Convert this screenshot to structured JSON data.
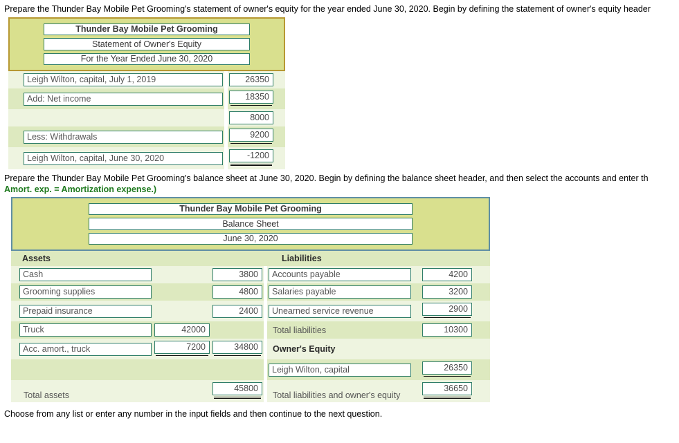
{
  "prompts": {
    "equity_prompt": "Prepare the Thunder Bay Mobile Pet Grooming's statement of owner's equity for the year ended June 30, 2020. Begin by defining the statement of owner's equity header",
    "balance_prompt_line1": "Prepare the Thunder Bay Mobile Pet Grooming's balance sheet at June 30, 2020. Begin by defining the balance sheet header, and then select the accounts and enter th",
    "balance_prompt_hint": "Amort. exp. = Amortization expense.)",
    "footer": "Choose from any list or enter any number in the input fields and then continue to the next question."
  },
  "equity_statement": {
    "header": {
      "company": "Thunder Bay Mobile Pet Grooming",
      "title": "Statement of Owner's Equity",
      "period": "For the Year Ended June 30, 2020"
    },
    "rows": [
      {
        "label": "Leigh Wilton, capital, July 1, 2019",
        "amount": "26350",
        "underline": "none"
      },
      {
        "label": "Add: Net income",
        "amount": "18350",
        "underline": "single"
      },
      {
        "label": "",
        "amount": "8000",
        "underline": "none"
      },
      {
        "label": "Less: Withdrawals",
        "amount": "9200",
        "underline": "single"
      },
      {
        "label": "Leigh Wilton, capital, June 30, 2020",
        "amount": "-1200",
        "underline": "double"
      }
    ]
  },
  "balance_sheet": {
    "header": {
      "company": "Thunder Bay Mobile Pet Grooming",
      "title": "Balance Sheet",
      "period": "June 30, 2020"
    },
    "section_headings": {
      "assets": "Assets",
      "liabilities": "Liabilities",
      "owners_equity": "Owner's Equity"
    },
    "asset_rows": [
      {
        "label": "Cash",
        "col1": "",
        "col2": "3800",
        "label_kind": "field",
        "col1_kind": "blank",
        "col2_kind": "field",
        "underline": "none"
      },
      {
        "label": "Grooming supplies",
        "col1": "",
        "col2": "4800",
        "label_kind": "field",
        "col1_kind": "blank",
        "col2_kind": "field",
        "underline": "none"
      },
      {
        "label": "Prepaid insurance",
        "col1": "",
        "col2": "2400",
        "label_kind": "field",
        "col1_kind": "blank",
        "col2_kind": "field",
        "underline": "none"
      },
      {
        "label": "Truck",
        "col1": "42000",
        "col2": "",
        "label_kind": "field",
        "col1_kind": "field",
        "col2_kind": "blank",
        "underline": "none"
      },
      {
        "label": "Acc. amort., truck",
        "col1": "7200",
        "col2": "34800",
        "label_kind": "field",
        "col1_kind": "field",
        "col2_kind": "field",
        "underline": "single"
      },
      {
        "label": "",
        "col1": "",
        "col2": "",
        "label_kind": "blank",
        "col1_kind": "blank",
        "col2_kind": "blank",
        "underline": "none"
      },
      {
        "label": "Total assets",
        "col1": "",
        "col2": "45800",
        "label_kind": "plain",
        "col1_kind": "blank",
        "col2_kind": "field",
        "underline": "double"
      }
    ],
    "liability_rows": [
      {
        "label": "Accounts payable",
        "amount": "4200",
        "label_kind": "field",
        "amount_kind": "field",
        "underline": "none",
        "bold": false
      },
      {
        "label": "Salaries payable",
        "amount": "3200",
        "label_kind": "field",
        "amount_kind": "field",
        "underline": "none",
        "bold": false
      },
      {
        "label": "Unearned service revenue",
        "amount": "2900",
        "label_kind": "field",
        "amount_kind": "field",
        "underline": "single",
        "bold": false
      },
      {
        "label": "Total liabilities",
        "amount": "10300",
        "label_kind": "plain",
        "amount_kind": "field",
        "underline": "none",
        "bold": false
      },
      {
        "label": "Owner's Equity",
        "amount": "",
        "label_kind": "bold",
        "amount_kind": "blank",
        "underline": "none",
        "bold": true
      },
      {
        "label": "Leigh Wilton, capital",
        "amount": "26350",
        "label_kind": "field",
        "amount_kind": "field",
        "underline": "single",
        "bold": false
      },
      {
        "label": "Total liabilities and owner's equity",
        "amount": "36650",
        "label_kind": "plain",
        "amount_kind": "field",
        "underline": "double",
        "bold": false
      }
    ]
  },
  "colors": {
    "header_fill": "#d9e08e",
    "header_border_gold": "#b79833",
    "header_border_blue": "#5f8fa6",
    "field_border": "#2e7d68",
    "stripe_light": "#eef4e0",
    "stripe_dark": "#dde9bf",
    "hint_green": "#1f7a1f"
  }
}
